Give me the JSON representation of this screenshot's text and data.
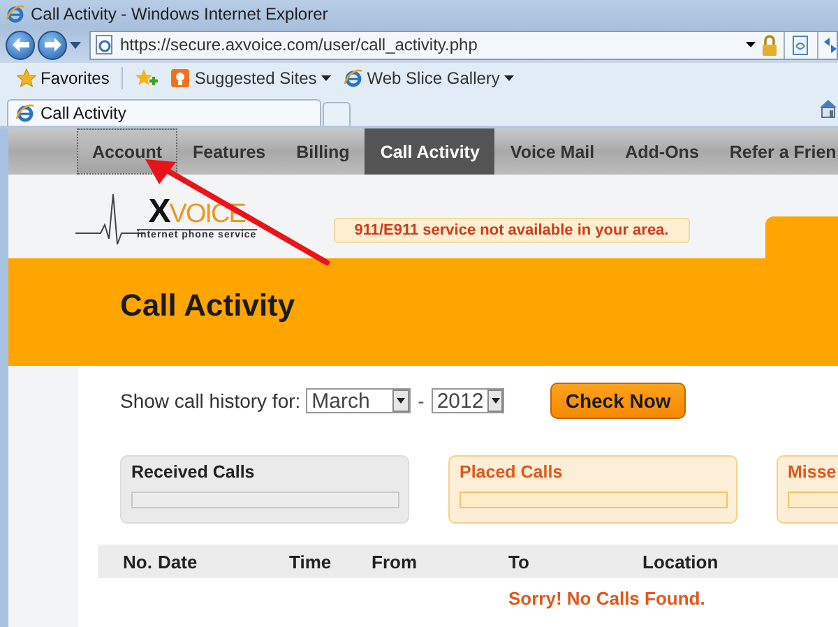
{
  "window": {
    "title": "Call Activity - Windows Internet Explorer"
  },
  "address_bar": {
    "url": "https://secure.axvoice.com/user/call_activity.php"
  },
  "favorites_bar": {
    "items": [
      {
        "label": "Favorites",
        "kind": "favorites"
      },
      {
        "label": "Suggested Sites",
        "kind": "suggested"
      },
      {
        "label": "Web Slice Gallery",
        "kind": "webslice"
      }
    ]
  },
  "tabs": [
    {
      "label": "Call Activity",
      "selected": true
    }
  ],
  "nav": {
    "items": [
      {
        "label": "Account",
        "selected": false,
        "hovered": true
      },
      {
        "label": "Features",
        "selected": false,
        "hovered": false
      },
      {
        "label": "Billing",
        "selected": false,
        "hovered": false
      },
      {
        "label": "Call Activity",
        "selected": true,
        "hovered": false
      },
      {
        "label": "Voice Mail",
        "selected": false,
        "hovered": false
      },
      {
        "label": "Add-Ons",
        "selected": false,
        "hovered": false
      },
      {
        "label": "Refer a Frien",
        "selected": false,
        "hovered": false
      }
    ]
  },
  "logo": {
    "mark": "X",
    "name": "VOICE",
    "tagline": "internet phone service"
  },
  "alert": {
    "text": "911/E911 service not available in your area."
  },
  "page_title": "Call Activity",
  "filter": {
    "label": "Show call history for:",
    "month": {
      "value": "March"
    },
    "separator": "-",
    "year": {
      "value": "2012"
    },
    "button": "Check Now"
  },
  "summaries": [
    {
      "title": "Received Calls",
      "kind": "received"
    },
    {
      "title": "Placed Calls",
      "kind": "placed"
    },
    {
      "title": "Misse",
      "kind": "missed"
    }
  ],
  "table": {
    "columns": [
      "No.",
      "Date",
      "Time",
      "From",
      "To",
      "Location"
    ],
    "empty_message": "Sorry! No Calls Found."
  }
}
